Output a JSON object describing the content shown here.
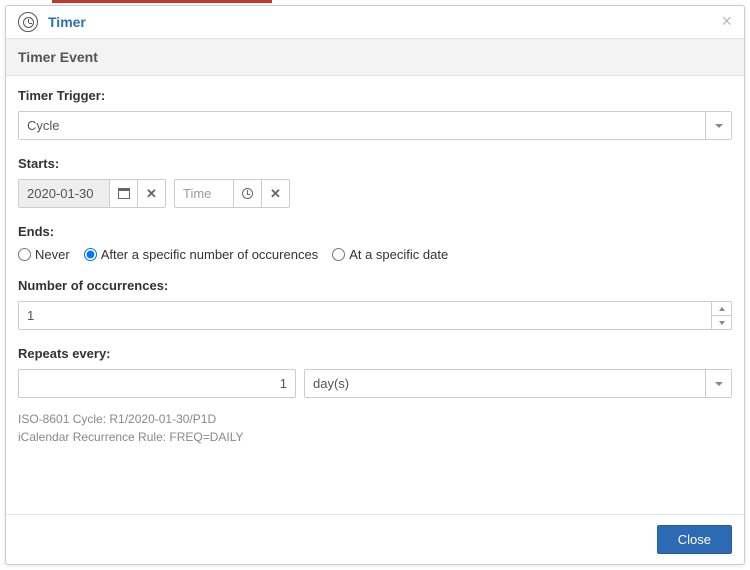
{
  "header": {
    "title": "Timer",
    "close_symbol": "×"
  },
  "section": {
    "title": "Timer Event"
  },
  "trigger": {
    "label": "Timer Trigger:",
    "value": "Cycle"
  },
  "starts": {
    "label": "Starts:",
    "date_value": "2020-01-30",
    "time_placeholder": "Time"
  },
  "ends": {
    "label": "Ends:",
    "options": {
      "never": "Never",
      "after": "After a specific number of occurences",
      "date": "At a specific date"
    },
    "selected": "after"
  },
  "occurrences": {
    "label": "Number of occurrences:",
    "value": "1"
  },
  "repeats": {
    "label": "Repeats every:",
    "value": "1",
    "unit": "day(s)"
  },
  "info": {
    "iso": "ISO-8601 Cycle: R1/2020-01-30/P1D",
    "ical": "iCalendar Recurrence Rule: FREQ=DAILY"
  },
  "footer": {
    "close_label": "Close"
  }
}
